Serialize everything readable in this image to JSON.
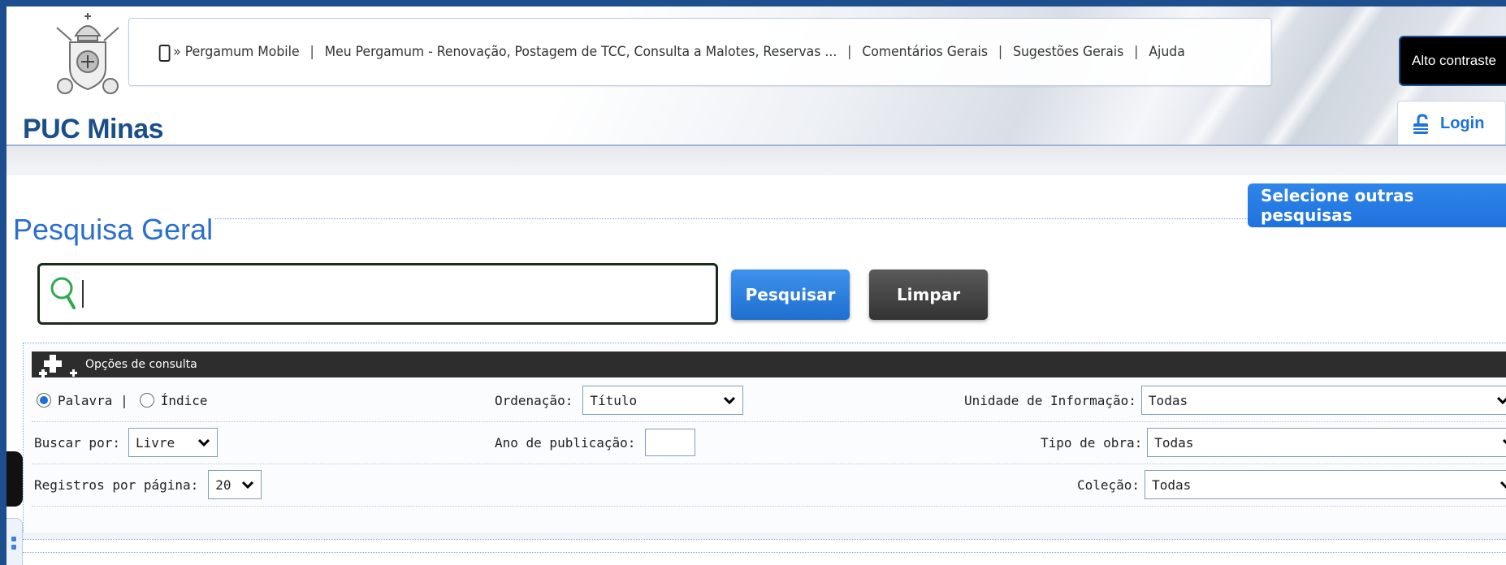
{
  "logo": {
    "text": "PUC Minas"
  },
  "topnav": {
    "items": [
      "» Pergamum Mobile",
      "Meu Pergamum - Renovação, Postagem de TCC, Consulta a Malotes, Reservas ...",
      "Comentários Gerais",
      "Sugestões Gerais",
      "Ajuda"
    ],
    "separator": "|"
  },
  "header": {
    "contrast_label": "Alto contraste",
    "login_label": "Login"
  },
  "page": {
    "title": "Pesquisa Geral",
    "other_searches_label": "Selecione outras pesquisas"
  },
  "search": {
    "value": "",
    "search_label": "Pesquisar",
    "clear_label": "Limpar"
  },
  "options": {
    "title": "Opções de consulta",
    "mode_word": "Palavra |",
    "mode_index": "Índice",
    "mode_selected": "Palavra",
    "buscar_por_label": "Buscar por:",
    "buscar_por_value": "Livre",
    "registros_label": "Registros por página:",
    "registros_value": "20",
    "ordenacao_label": "Ordenação:",
    "ordenacao_value": "Título",
    "ano_label": "Ano de publicação:",
    "ano_value": "",
    "unidade_label": "Unidade de Informação:",
    "unidade_value": "Todas",
    "tipo_label": "Tipo de obra:",
    "tipo_value": "Todas",
    "colecao_label": "Coleção:",
    "colecao_value": "Todas"
  },
  "colors": {
    "frame": "#1d4f8f",
    "brand_blue": "#1b4f8a",
    "link_blue": "#2a6fcb",
    "button_blue": "#1f72dc",
    "button_dark": "#333333",
    "options_bar": "#2d2d2d",
    "search_icon": "#2fa84f"
  },
  "icons": {
    "crest": "papal-crest-icon",
    "mobile": "mobile-phone-icon",
    "lock": "unlock-icon",
    "search": "magnifier-icon",
    "expand": "plus-icon",
    "dropdown": "chevron-down-icon"
  }
}
